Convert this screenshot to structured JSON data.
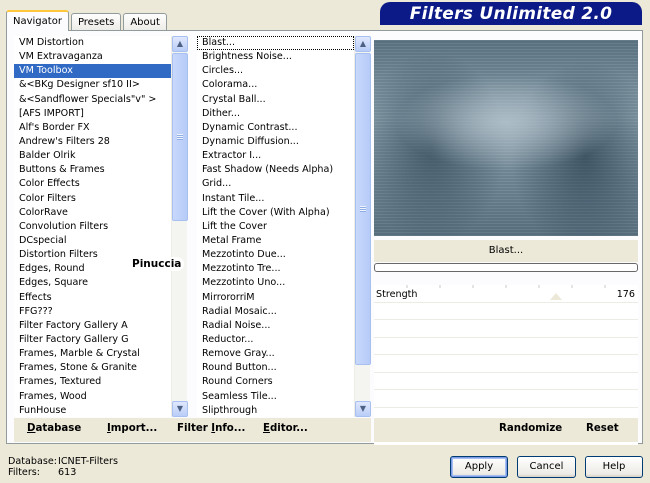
{
  "title": "Filters Unlimited 2.0",
  "tabs": [
    "Navigator",
    "Presets",
    "About"
  ],
  "categories": {
    "selected_index": 2,
    "items": [
      "VM Distortion",
      "VM Extravaganza",
      "VM Toolbox",
      "&<BKg Designer sf10 II>",
      "&<Sandflower Specials\"v\" >",
      "[AFS IMPORT]",
      "Alf's Border FX",
      "Andrew's Filters 28",
      "Balder Olrik",
      "Buttons & Frames",
      "Color Effects",
      "Color Filters",
      "ColorRave",
      "Convolution Filters",
      "DCspecial",
      "Distortion Filters",
      "Edges, Round",
      "Edges, Square",
      "Effects",
      "FFG???",
      "Filter Factory Gallery A",
      "Filter Factory Gallery G",
      "Frames, Marble & Crystal",
      "Frames, Stone & Granite",
      "Frames, Textured",
      "Frames, Wood",
      "FunHouse"
    ]
  },
  "filters": {
    "selected_index": 0,
    "items": [
      "Blast...",
      "Brightness Noise...",
      "Circles...",
      "Colorama...",
      "Crystal Ball...",
      "Dither...",
      "Dynamic Contrast...",
      "Dynamic Diffusion...",
      "Extractor I...",
      "Fast Shadow (Needs Alpha)",
      "Grid...",
      "Instant Tile...",
      "Lift the Cover (With Alpha)",
      "Lift the Cover",
      "Metal Frame",
      "Mezzotinto Due...",
      "Mezzotinto Tre...",
      "Mezzotinto Uno...",
      "MirrororriM",
      "Radial Mosaic...",
      "Radial Noise...",
      "Reductor...",
      "Remove Gray...",
      "Round Button...",
      "Round Corners",
      "Seamless Tile...",
      "Slipthrough"
    ]
  },
  "preview": {
    "filter_name": "Blast..."
  },
  "parameters": [
    {
      "label": "Strength",
      "value": "176"
    }
  ],
  "bottom_buttons": {
    "database": {
      "u": "D",
      "rest": "atabase"
    },
    "import": {
      "u": "I",
      "rest": "mport..."
    },
    "filter_info": {
      "pre": "Filter ",
      "u": "I",
      "rest": "nfo..."
    },
    "editor": {
      "u": "E",
      "rest": "ditor..."
    },
    "randomize": "Randomize",
    "reset": "Reset"
  },
  "status": {
    "database_label": "Database:",
    "database_value": "ICNET-Filters",
    "filters_label": "Filters:",
    "filters_value": "613"
  },
  "dialog_buttons": {
    "apply": "Apply",
    "cancel": "Cancel",
    "help": "Help"
  },
  "watermark": "Pinuccia",
  "colors": {
    "selection": "#316ac5",
    "title_bar": "#0b1a87",
    "face": "#ece9d8"
  }
}
